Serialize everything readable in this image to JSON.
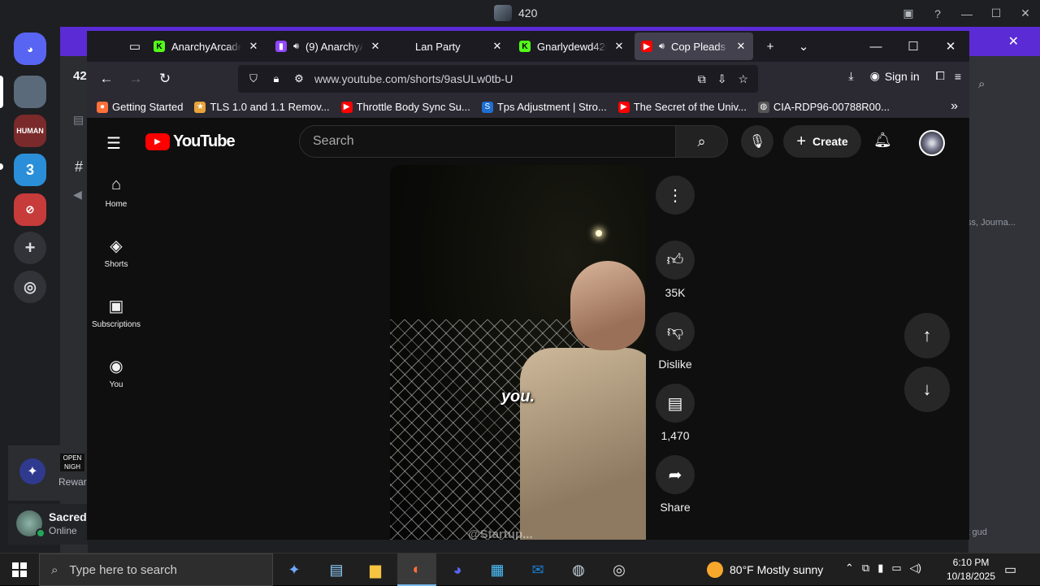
{
  "discord": {
    "window_title": "420",
    "channel_prefix": "42",
    "channel_hash": "#",
    "right_text": "ss, Journa...",
    "right_text2": "it gud",
    "servers": [
      {
        "label": "",
        "color": "#5a6a7a"
      },
      {
        "label": "HUMAN",
        "color": "#7a2a2a"
      },
      {
        "label": "3",
        "color": "#2a8fd8"
      },
      {
        "label": "",
        "color": "#c73b3b"
      }
    ],
    "activity_label": "Rewar",
    "activity_badge": "OPEN NIGH",
    "user": {
      "name": "Sacred",
      "status": "Online"
    }
  },
  "firefox": {
    "tabs": [
      {
        "label": "AnarchyArcade S",
        "icon": "kick-icon",
        "color": "#53fc18",
        "glyph": "K",
        "audio": false,
        "active": false
      },
      {
        "label": "(9) AnarchyA",
        "icon": "twitch-icon",
        "color": "#9146ff",
        "glyph": "▮",
        "audio": true,
        "active": false
      },
      {
        "label": "Lan Party",
        "icon": "",
        "color": "",
        "glyph": "",
        "audio": false,
        "active": false
      },
      {
        "label": "Gnarlydewd420 S",
        "icon": "kick-icon",
        "color": "#53fc18",
        "glyph": "K",
        "audio": false,
        "active": false
      },
      {
        "label": "Cop Pleads T",
        "icon": "youtube-icon",
        "color": "#ff0000",
        "glyph": "▶",
        "audio": true,
        "active": true
      }
    ],
    "url": "www.youtube.com/shorts/9asULw0tb-U",
    "sign_in": "Sign in",
    "bookmarks": [
      {
        "label": "Getting Started",
        "icon": "firefox-icon",
        "color": "#ff7139"
      },
      {
        "label": "TLS 1.0 and 1.1 Remov...",
        "icon": "star-icon",
        "color": "#e8a33a"
      },
      {
        "label": "Throttle Body Sync Su...",
        "icon": "youtube-icon",
        "color": "#ff0000"
      },
      {
        "label": "Tps Adjustment | Stro...",
        "icon": "s-icon",
        "color": "#1f6fd1"
      },
      {
        "label": "The Secret of the Univ...",
        "icon": "youtube-icon",
        "color": "#ff0000"
      },
      {
        "label": "CIA-RDP96-00788R00...",
        "icon": "globe-icon",
        "color": "#555"
      }
    ]
  },
  "youtube": {
    "logo": "YouTube",
    "search_placeholder": "Search",
    "create_label": "Create",
    "guide": [
      {
        "label": "Home",
        "icon": "home-icon",
        "glyph": "⌂"
      },
      {
        "label": "Shorts",
        "icon": "shorts-icon",
        "glyph": "◈"
      },
      {
        "label": "Subscriptions",
        "icon": "subscriptions-icon",
        "glyph": "▣"
      },
      {
        "label": "You",
        "icon": "you-icon",
        "glyph": "◉"
      }
    ],
    "caption": "you.",
    "watermark": "@Startup...",
    "actions": {
      "like_count": "35K",
      "dislike_label": "Dislike",
      "comment_count": "1,470",
      "share_label": "Share"
    }
  },
  "taskbar": {
    "search_placeholder": "Type here to search",
    "weather": "80°F  Mostly sunny",
    "time": "6:10 PM",
    "date": "10/18/2025",
    "accent": "#76b9ed"
  }
}
